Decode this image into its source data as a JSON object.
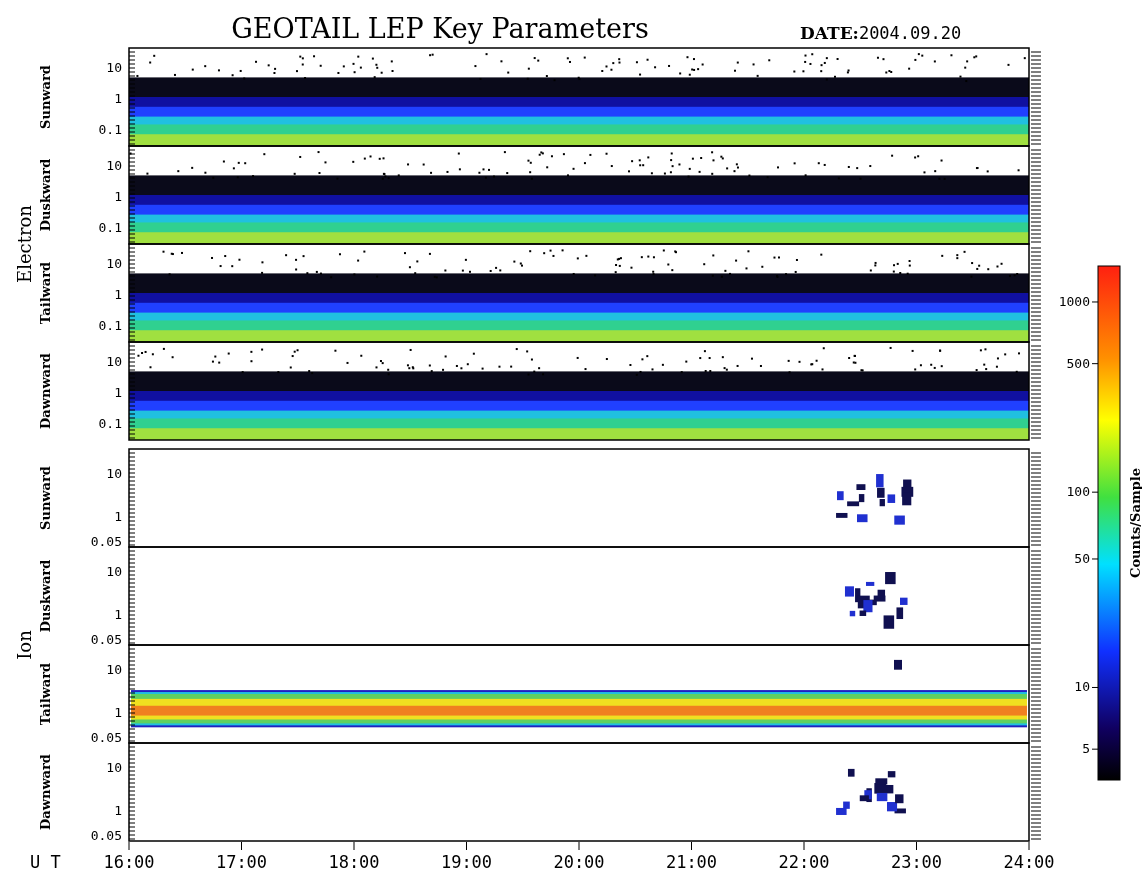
{
  "title": "GEOTAIL LEP Key Parameters",
  "date": {
    "label": "DATE:",
    "value": "2004.09.20"
  },
  "groups": [
    {
      "name": "Electron",
      "kind": "electron",
      "panels": [
        {
          "label": "Sunward",
          "kind": "full",
          "yticks": [
            "10",
            "1",
            "0.1"
          ]
        },
        {
          "label": "Duskward",
          "kind": "full",
          "yticks": [
            "10",
            "1",
            "0.1"
          ]
        },
        {
          "label": "Tailward",
          "kind": "full",
          "yticks": [
            "10",
            "1",
            "0.1"
          ]
        },
        {
          "label": "Dawnward",
          "kind": "full",
          "yticks": [
            "10",
            "1",
            "0.1"
          ]
        }
      ]
    },
    {
      "name": "Ion",
      "kind": "ion",
      "panels": [
        {
          "label": "Sunward",
          "kind": "patchy",
          "yticks": [
            "10",
            "1",
            "0.05"
          ]
        },
        {
          "label": "Duskward",
          "kind": "patchy",
          "yticks": [
            "10",
            "1",
            "0.05"
          ]
        },
        {
          "label": "Tailward",
          "kind": "beam",
          "yticks": [
            "10",
            "1",
            "0.05"
          ]
        },
        {
          "label": "Dawnward",
          "kind": "patchy",
          "yticks": [
            "10",
            "1",
            "0.05"
          ]
        }
      ]
    }
  ],
  "xaxis": {
    "label": "U T",
    "ticks": [
      "16:00",
      "17:00",
      "18:00",
      "19:00",
      "20:00",
      "21:00",
      "22:00",
      "23:00",
      "24:00"
    ]
  },
  "colorbar": {
    "title": "Counts/Sample",
    "ticks": [
      "1000",
      "500",
      "100",
      "50",
      "10",
      "5"
    ]
  }
}
